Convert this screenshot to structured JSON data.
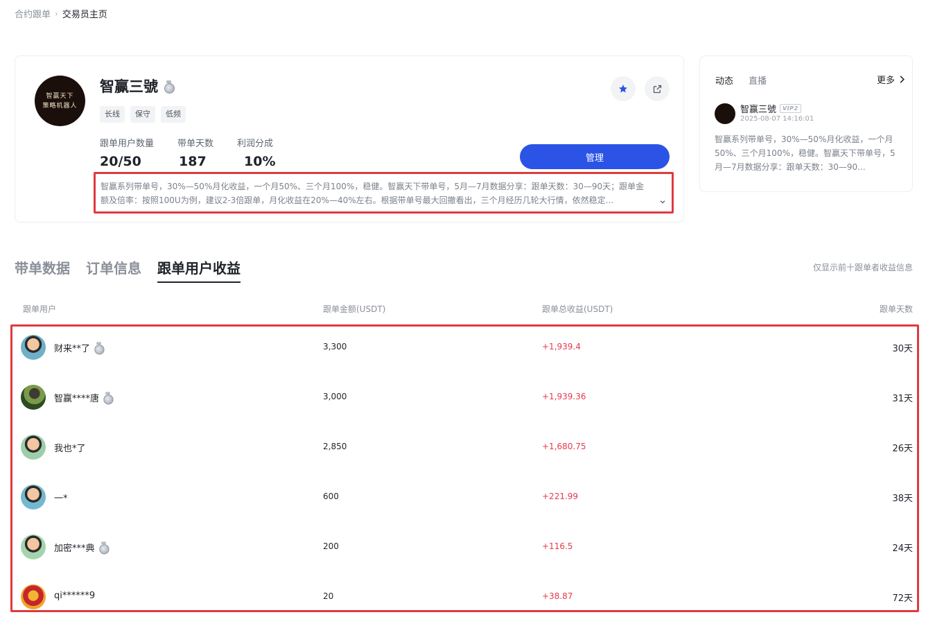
{
  "breadcrumb": {
    "parent": "合约跟单",
    "current": "交易员主页"
  },
  "trader": {
    "avatar_line1": "智赢天下",
    "avatar_line2": "策略机器人",
    "name": "智赢三號",
    "tags": [
      "长线",
      "保守",
      "低频"
    ],
    "stats": [
      {
        "label": "跟单用户数量",
        "value": "20/50"
      },
      {
        "label": "带单天数",
        "value": "187"
      },
      {
        "label": "利润分成",
        "value": "10%"
      }
    ],
    "manage_label": "管理",
    "description": "智赢系列带单号，30%—50%月化收益，一个月50%、三个月100%，稳健。智赢天下带单号，5月—7月数据分享：跟单天数：30—90天；跟单金额及倍率：按照100U为例，建议2-3倍跟单，月化收益在20%—40%左右。根据带单号最大回撤看出，三个月经历几轮大行情，依然稳定..."
  },
  "feed": {
    "tabs": [
      "动态",
      "直播"
    ],
    "more_label": "更多",
    "post": {
      "author": "智赢三號",
      "badge": "VIP2",
      "time": "2025-08-07 14:16:01",
      "text": "智赢系列带单号，30%—50%月化收益，一个月50%、三个月100%，稳健。智赢天下带单号，5月—7月数据分享：跟单天数：30—90..."
    }
  },
  "sections": {
    "tabs": [
      "带单数据",
      "订单信息",
      "跟单用户收益"
    ],
    "active_index": 2,
    "note": "仅显示前十跟单者收益信息"
  },
  "table": {
    "headers": [
      "跟单用户",
      "跟单金额(USDT)",
      "跟单总收益(USDT)",
      "跟单天数"
    ],
    "rows": [
      {
        "user": "财来**了",
        "medal": true,
        "amount": "3,300",
        "profit": "+1,939.4",
        "days": "30天"
      },
      {
        "user": "智赢****唐",
        "medal": true,
        "amount": "3,000",
        "profit": "+1,939.36",
        "days": "31天"
      },
      {
        "user": "我也*了",
        "medal": false,
        "amount": "2,850",
        "profit": "+1,680.75",
        "days": "26天"
      },
      {
        "user": "一*",
        "medal": false,
        "amount": "600",
        "profit": "+221.99",
        "days": "38天"
      },
      {
        "user": "加密***典",
        "medal": true,
        "amount": "200",
        "profit": "+116.5",
        "days": "24天"
      },
      {
        "user": "qi******9",
        "medal": false,
        "amount": "20",
        "profit": "+38.87",
        "days": "72天"
      }
    ]
  },
  "colors": {
    "accent": "#2b54e6",
    "profit": "#e6394e",
    "highlight": "#e0393e"
  }
}
